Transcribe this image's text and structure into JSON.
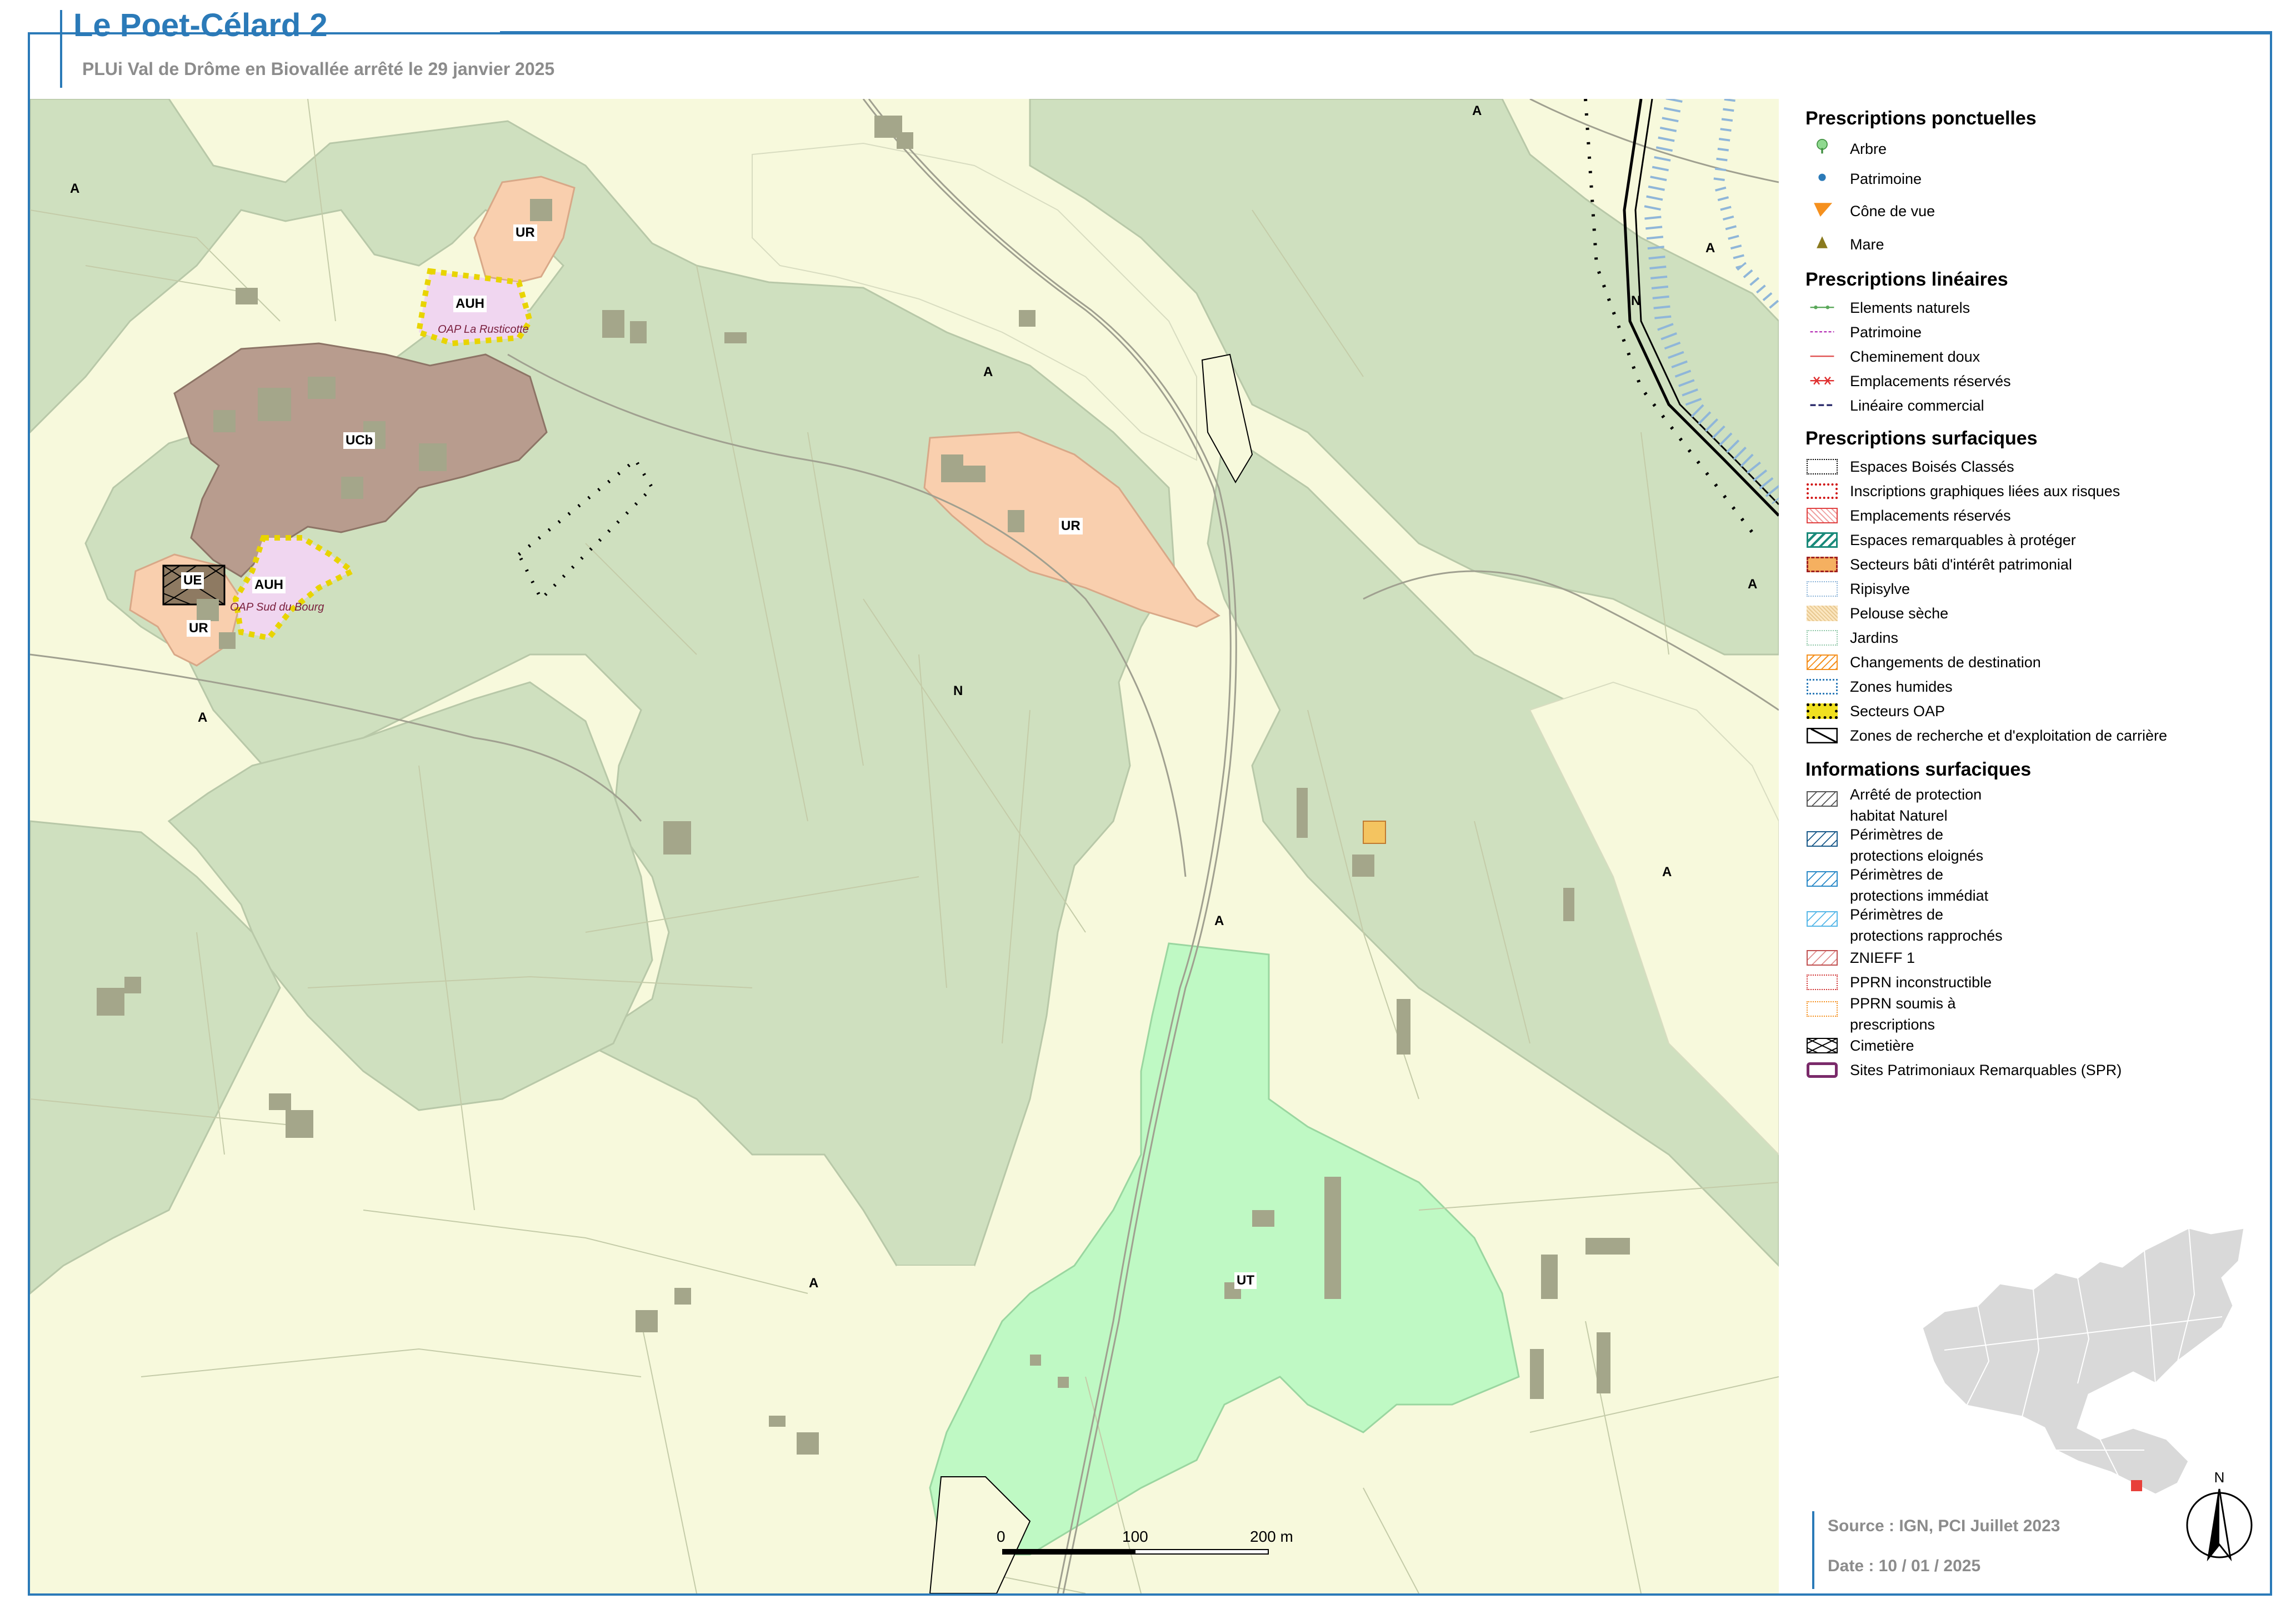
{
  "header": {
    "title": "Le Poet-Célard 2",
    "subtitle": "PLUi Val de Drôme en Biovallée arrêté le 29 janvier 2025"
  },
  "zones": {
    "A": "A",
    "N": "N",
    "UR": "UR",
    "AUH": "AUH",
    "UCb": "UCb",
    "UE": "UE",
    "UT": "UT",
    "oap_rusticotte": "OAP La Rusticotte",
    "oap_sud_bourg": "OAP Sud du Bourg"
  },
  "legend": {
    "ponctuelles": {
      "title": "Prescriptions ponctuelles",
      "items": [
        "Arbre",
        "Patrimoine",
        "Cône de vue",
        "Mare"
      ]
    },
    "lineaires": {
      "title": "Prescriptions linéaires",
      "items": [
        "Elements naturels",
        "Patrimoine",
        "Cheminement doux",
        "Emplacements réservés",
        "Linéaire commercial"
      ]
    },
    "surfaciques": {
      "title": "Prescriptions surfaciques",
      "items": [
        "Espaces Boisés Classés",
        "Inscriptions graphiques liées aux risques",
        "Emplacements réservés",
        "Espaces remarquables à protéger",
        "Secteurs bâti d'intérêt patrimonial",
        "Ripisylve",
        "Pelouse sèche",
        "Jardins",
        "Changements de destination",
        "Zones humides",
        "Secteurs OAP",
        "Zones de recherche et d'exploitation de carrière"
      ]
    },
    "informations": {
      "title": "Informations surfaciques",
      "items": [
        "Arrêté de protection",
        "habitat Naturel",
        "Périmètres de",
        "protections eloignés",
        "Périmètres de",
        "protections immédiat",
        "Périmètres de",
        "protections rapprochés",
        "ZNIEFF 1",
        "PPRN inconstructible",
        "PPRN soumis à",
        "prescriptions",
        "Cimetière",
        "Sites Patrimoniaux Remarquables (SPR)"
      ]
    }
  },
  "scale": {
    "zero": "0",
    "mid": "100",
    "end": "200 m"
  },
  "footer": {
    "source": "Source : IGN, PCI Juillet 2023",
    "date": "Date : 10 / 01 / 2025"
  },
  "north": "N",
  "colors": {
    "frame": "#2b7ab8",
    "agricultural": "#f7f9dc",
    "natural": "#cfe0bf",
    "ur": "#f9cfae",
    "auh": "#f0d6f0",
    "ucb": "#b89c8e",
    "ut": "#bff9c4",
    "building": "#a4a68a"
  }
}
